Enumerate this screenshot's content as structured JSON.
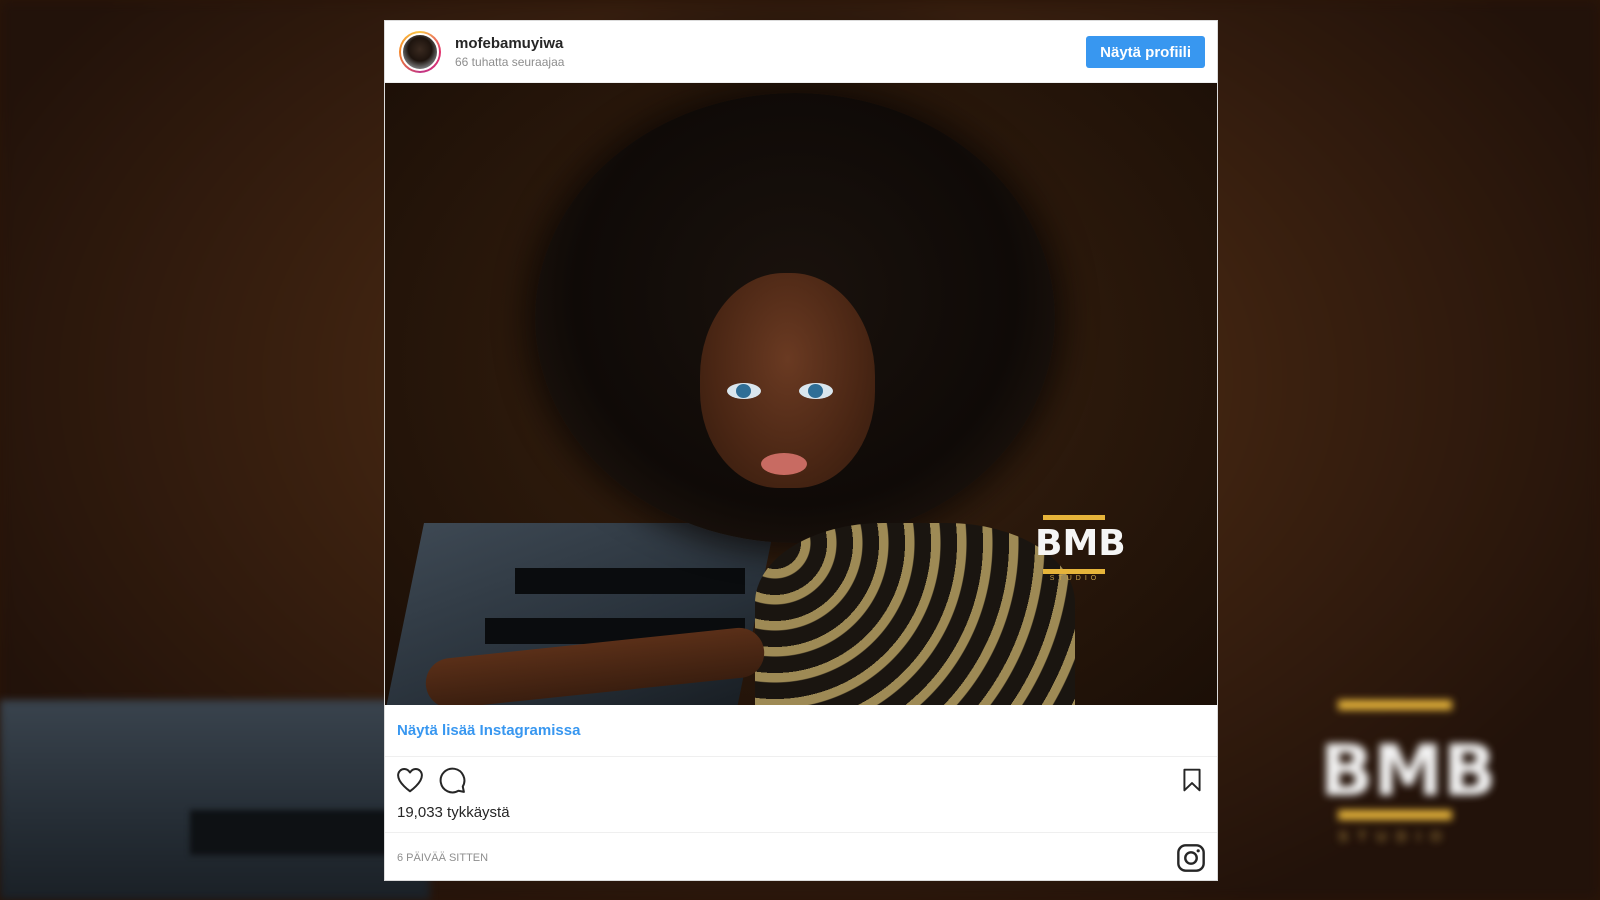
{
  "post": {
    "username": "mofebamuyiwa",
    "followers": "66 tuhatta seuraajaa",
    "profile_button": "Näytä profiili",
    "image_alt": "Portrait of a young girl with voluminous afro hair",
    "watermark": {
      "main": "BMB",
      "sub": "STUDIO"
    },
    "more_link": "Näytä lisää Instagramissa",
    "likes": "19,033 tykkäystä",
    "timestamp": "6 PÄIVÄÄ SITTEN"
  },
  "colors": {
    "accent": "#3897f0",
    "logo_gold": "#e6b43a"
  },
  "icons": {
    "like": "heart-icon",
    "comment": "comment-icon",
    "save": "bookmark-icon",
    "instagram": "instagram-icon"
  }
}
